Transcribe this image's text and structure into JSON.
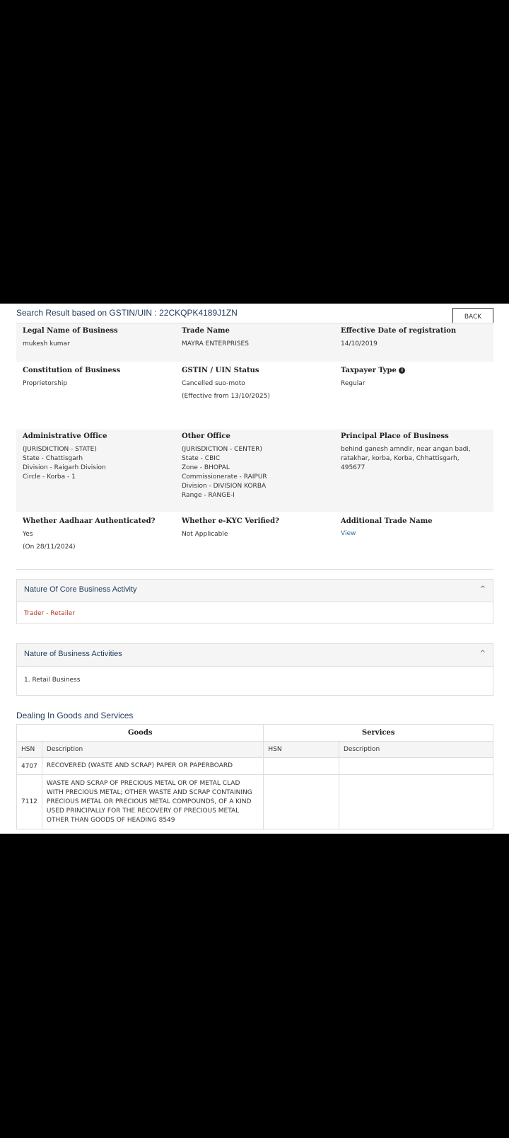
{
  "header": {
    "search_label": "Search Result based on GSTIN/UIN :",
    "gstin": "22CKQPK4189J1ZN",
    "back_label": "BACK"
  },
  "row1": {
    "legal_name_label": "Legal Name of Business",
    "legal_name": "mukesh kumar",
    "trade_name_label": "Trade Name",
    "trade_name": "MAYRA ENTERPRISES",
    "eff_date_label": "Effective Date of registration",
    "eff_date": "14/10/2019"
  },
  "row2": {
    "constitution_label": "Constitution of Business",
    "constitution": "Proprietorship",
    "status_label": "GSTIN / UIN Status",
    "status": "Cancelled suo-moto",
    "status_effective": "(Effective from 13/10/2025)",
    "taxpayer_type_label": "Taxpayer Type",
    "taxpayer_type": "Regular"
  },
  "row3": {
    "admin_label": "Administrative Office",
    "admin_lines": [
      "(JURISDICTION - STATE)",
      "State - Chattisgarh",
      "Division - Raigarh Division",
      "Circle - Korba - 1"
    ],
    "other_label": "Other Office",
    "other_lines": [
      "(JURISDICTION - CENTER)",
      "State - CBIC",
      "Zone - BHOPAL",
      "Commissionerate - RAIPUR",
      "Division - DIVISION KORBA",
      "Range - RANGE-I"
    ],
    "ppob_label": "Principal Place of Business",
    "ppob_lines": [
      "behind ganesh amndir, near angan badi,",
      "ratakhar, korba, Korba, Chhattisgarh,",
      "495677"
    ]
  },
  "row4": {
    "aadhaar_label": "Whether Aadhaar Authenticated?",
    "aadhaar": "Yes",
    "aadhaar_date": "(On 28/11/2024)",
    "ekyc_label": "Whether e-KYC Verified?",
    "ekyc": "Not Applicable",
    "addl_trade_label": "Additional Trade Name",
    "addl_trade_link": "View"
  },
  "core_activity": {
    "title": "Nature Of Core Business Activity",
    "value": "Trader - Retailer"
  },
  "business_activities": {
    "title": "Nature of Business Activities",
    "items": [
      "1. Retail Business"
    ]
  },
  "goods_services": {
    "title": "Dealing In Goods and Services",
    "goods_label": "Goods",
    "services_label": "Services",
    "hsn_label": "HSN",
    "desc_label": "Description",
    "rows": [
      {
        "hsn": "4707",
        "desc": [
          "RECOVERED (WASTE AND SCRAP) PAPER OR PAPERBOARD"
        ]
      },
      {
        "hsn": "7112",
        "desc": [
          "WASTE AND SCRAP OF PRECIOUS METAL OR OF METAL CLAD",
          "WITH PRECIOUS METAL; OTHER WASTE AND SCRAP CONTAINING",
          "PRECIOUS METAL OR PRECIOUS METAL COMPOUNDS, OF A KIND",
          "USED PRINCIPALLY FOR THE RECOVERY OF PRECIOUS METAL",
          "OTHER THAN GOODS OF HEADING 8549"
        ]
      }
    ]
  },
  "icons": {
    "info": "info-icon",
    "collapse": "chevron-up-icon"
  },
  "colors": {
    "link": "#2f6fa0",
    "core_activity": "#b23a2a",
    "shaded_row": "#f5f5f5"
  }
}
